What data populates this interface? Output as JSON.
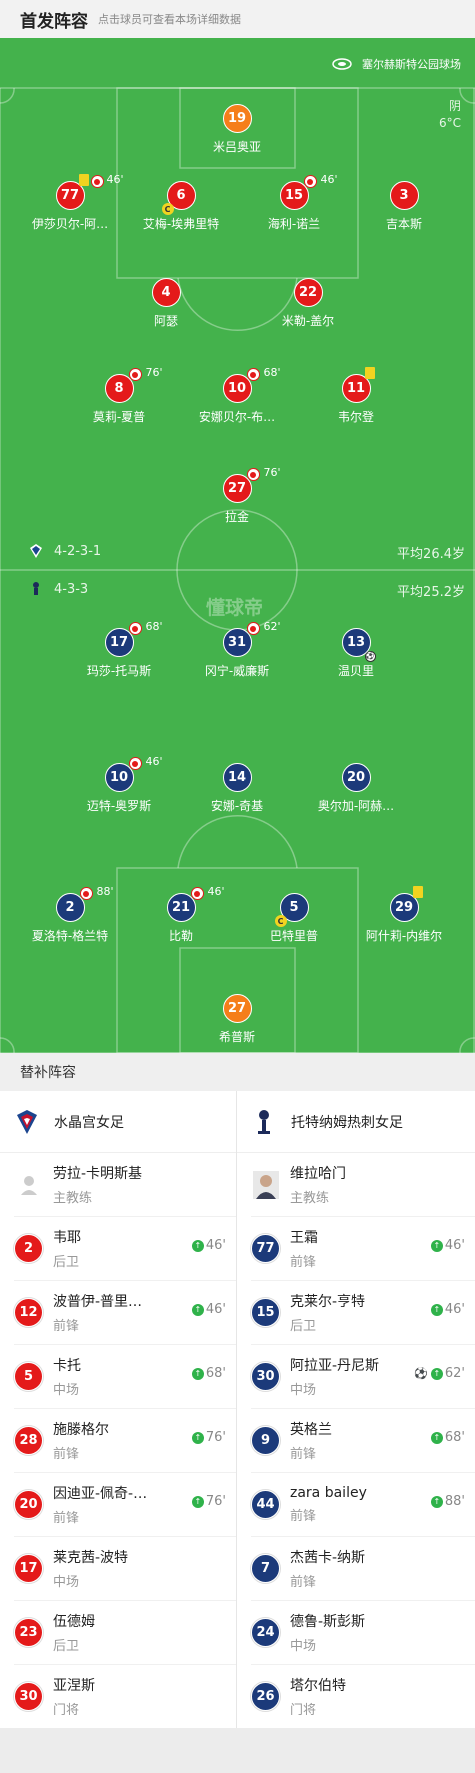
{
  "header": {
    "title": "首发阵容",
    "subtitle": "点击球员可查看本场详细数据"
  },
  "venue": {
    "name": "塞尔赫斯特公园球场"
  },
  "weather": {
    "condition": "阴",
    "temp": "6°C"
  },
  "home": {
    "formation": "4-2-3-1",
    "avg_age": "平均26.4岁",
    "players": [
      {
        "num": "19",
        "name": "米吕奥亚",
        "color": "orange"
      },
      {
        "num": "77",
        "name": "伊莎贝尔-阿…",
        "color": "red",
        "sub": "46'",
        "yellow": true
      },
      {
        "num": "6",
        "name": "艾梅-埃弗里特",
        "color": "red",
        "captain": true
      },
      {
        "num": "15",
        "name": "海利-诺兰",
        "color": "red",
        "sub": "46'"
      },
      {
        "num": "3",
        "name": "吉本斯",
        "color": "red"
      },
      {
        "num": "4",
        "name": "阿瑟",
        "color": "red"
      },
      {
        "num": "22",
        "name": "米勒-盖尔",
        "color": "red"
      },
      {
        "num": "8",
        "name": "莫莉-夏普",
        "color": "red",
        "sub": "76'"
      },
      {
        "num": "10",
        "name": "安娜贝尔-布…",
        "color": "red",
        "sub": "68'"
      },
      {
        "num": "11",
        "name": "韦尔登",
        "color": "red",
        "yellow": true
      },
      {
        "num": "27",
        "name": "拉金",
        "color": "red",
        "sub": "76'"
      }
    ]
  },
  "away": {
    "formation": "4-3-3",
    "avg_age": "平均25.2岁",
    "players": [
      {
        "num": "17",
        "name": "玛莎-托马斯",
        "color": "navy",
        "sub": "68'"
      },
      {
        "num": "31",
        "name": "冈宁-威廉斯",
        "color": "navy",
        "sub": "62'"
      },
      {
        "num": "13",
        "name": "温贝里",
        "color": "navy",
        "goal": true
      },
      {
        "num": "10",
        "name": "迈特-奥罗斯",
        "color": "navy",
        "sub": "46'"
      },
      {
        "num": "14",
        "name": "安娜-奇基",
        "color": "navy"
      },
      {
        "num": "20",
        "name": "奥尔加-阿赫…",
        "color": "navy"
      },
      {
        "num": "2",
        "name": "夏洛特-格兰特",
        "color": "navy",
        "sub": "88'"
      },
      {
        "num": "21",
        "name": "比勒",
        "color": "navy",
        "sub": "46'"
      },
      {
        "num": "5",
        "name": "巴特里普",
        "color": "navy",
        "captain": true
      },
      {
        "num": "29",
        "name": "阿什莉-内维尔",
        "color": "navy",
        "yellow": true
      },
      {
        "num": "27",
        "name": "希普斯",
        "color": "orange"
      }
    ]
  },
  "watermark": "懂球帝",
  "subs_section": {
    "title": "替补阵容",
    "home_team": "水晶宫女足",
    "away_team": "托特纳姆热刺女足",
    "home_coach": {
      "name": "劳拉-卡明斯基",
      "role": "主教练"
    },
    "away_coach": {
      "name": "维拉哈门",
      "role": "主教练"
    },
    "home_subs": [
      {
        "num": "2",
        "name": "韦耶",
        "pos": "后卫",
        "time": "46'"
      },
      {
        "num": "12",
        "name": "波普伊-普里…",
        "pos": "前锋",
        "time": "46'"
      },
      {
        "num": "5",
        "name": "卡托",
        "pos": "中场",
        "time": "68'"
      },
      {
        "num": "28",
        "name": "施滕格尔",
        "pos": "前锋",
        "time": "76'"
      },
      {
        "num": "20",
        "name": "因迪亚-佩奇-…",
        "pos": "前锋",
        "time": "76'"
      },
      {
        "num": "17",
        "name": "莱克茜-波特",
        "pos": "中场",
        "time": ""
      },
      {
        "num": "23",
        "name": "伍德姆",
        "pos": "后卫",
        "time": ""
      },
      {
        "num": "30",
        "name": "亚涅斯",
        "pos": "门将",
        "time": ""
      }
    ],
    "away_subs": [
      {
        "num": "77",
        "name": "王霜",
        "pos": "前锋",
        "time": "46'"
      },
      {
        "num": "15",
        "name": "克莱尔-亨特",
        "pos": "后卫",
        "time": "46'"
      },
      {
        "num": "30",
        "name": "阿拉亚-丹尼斯",
        "pos": "中场",
        "time": "62'",
        "goal": true
      },
      {
        "num": "9",
        "name": "英格兰",
        "pos": "前锋",
        "time": "68'"
      },
      {
        "num": "44",
        "name": "zara bailey",
        "pos": "前锋",
        "time": "88'"
      },
      {
        "num": "7",
        "name": "杰茜卡-纳斯",
        "pos": "前锋",
        "time": ""
      },
      {
        "num": "24",
        "name": "德鲁-斯彭斯",
        "pos": "中场",
        "time": ""
      },
      {
        "num": "26",
        "name": "塔尔伯特",
        "pos": "门将",
        "time": ""
      }
    ]
  }
}
